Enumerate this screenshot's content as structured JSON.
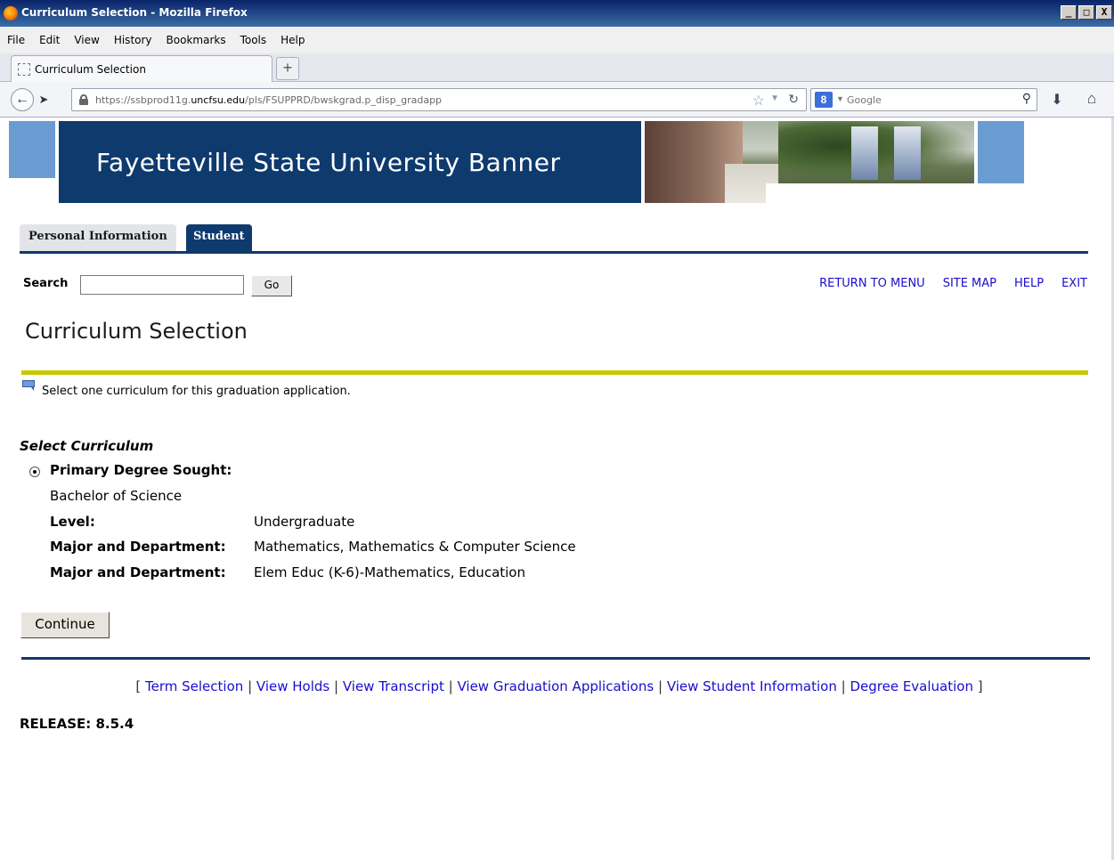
{
  "window": {
    "title": "Curriculum Selection - Mozilla Firefox",
    "controls": [
      "_",
      "□",
      "X"
    ]
  },
  "menubar": [
    "File",
    "Edit",
    "View",
    "History",
    "Bookmarks",
    "Tools",
    "Help"
  ],
  "tab": {
    "label": "Curriculum Selection",
    "new_tab": "+"
  },
  "navbar": {
    "url_prefix": "https://ssbprod11g.",
    "url_domain": "uncfsu.edu",
    "url_path": "/pls/FSUPPRD/bwskgrad.p_disp_gradapp",
    "search_placeholder": "Google",
    "search_engine_glyph": "8"
  },
  "banner": {
    "title": "Fayetteville State University Banner"
  },
  "nav_tabs": {
    "personal": "Personal Information",
    "student": "Student"
  },
  "search": {
    "label": "Search",
    "go": "Go"
  },
  "top_links": [
    "RETURN TO MENU",
    "SITE MAP",
    "HELP",
    "EXIT"
  ],
  "page_title": "Curriculum Selection",
  "info_text": "Select one curriculum for this graduation application.",
  "curriculum": {
    "section_title": "Select Curriculum",
    "primary_label": "Primary Degree Sought:",
    "degree": "Bachelor of Science",
    "level_label": "Level:",
    "level_value": "Undergraduate",
    "major_label": "Major and Department:",
    "major1": "Mathematics, Mathematics & Computer Science",
    "major2": "Elem Educ (K-6)-Mathematics, Education",
    "primary_selected": true
  },
  "continue_label": "Continue",
  "bottom_links": [
    "Term Selection",
    "View Holds",
    "View Transcript",
    "View Graduation Applications",
    "View Student Information",
    "Degree Evaluation"
  ],
  "bracket_open": "[",
  "bracket_close": "]",
  "link_separator": "|",
  "release": "RELEASE: 8.5.4",
  "colors": {
    "banner_navy": "#0e3a6e",
    "accent_blue": "#6a9bd1",
    "yellow_rule": "#c8c800",
    "link": "#1a0dcc"
  }
}
